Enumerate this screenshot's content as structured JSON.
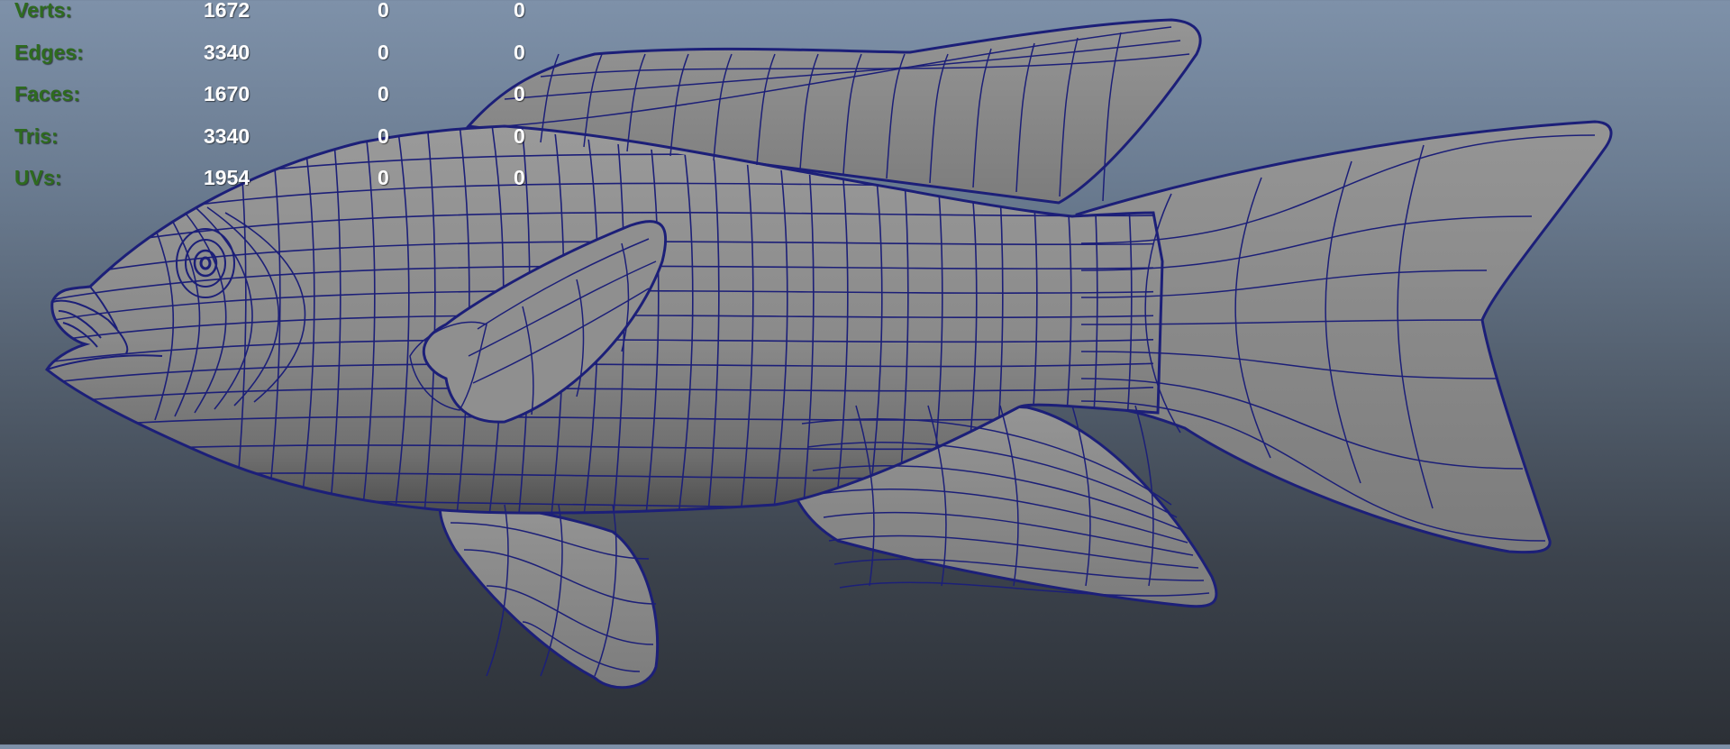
{
  "hud": {
    "label_color": "#2e6b1f",
    "value_color": "#ffffff",
    "rows": [
      {
        "label": "Verts:",
        "total": "1672",
        "selected": "0",
        "selected2": "0"
      },
      {
        "label": "Edges:",
        "total": "3340",
        "selected": "0",
        "selected2": "0"
      },
      {
        "label": "Faces:",
        "total": "1670",
        "selected": "0",
        "selected2": "0"
      },
      {
        "label": "Tris:",
        "total": "3340",
        "selected": "0",
        "selected2": "0"
      },
      {
        "label": "UVs:",
        "total": "1954",
        "selected": "0",
        "selected2": "0"
      }
    ]
  },
  "model": {
    "name": "fish-mesh",
    "shading_color": "#8c8c8c",
    "wire_color": "#1c1f78"
  },
  "viewport": {
    "gradient_top": "#7e91a9",
    "gradient_bottom": "#2c3036"
  }
}
